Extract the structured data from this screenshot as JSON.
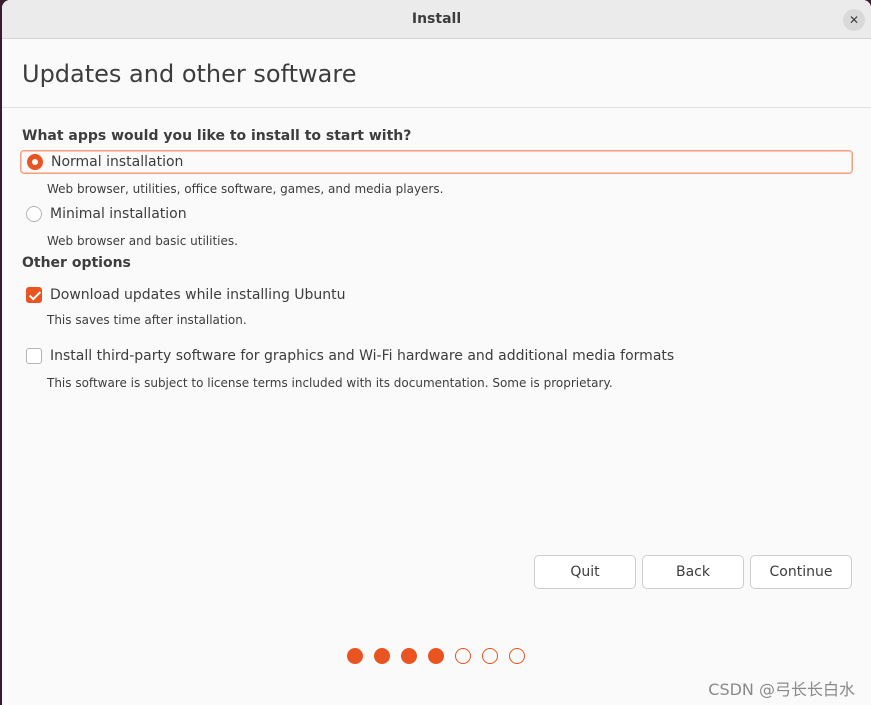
{
  "window": {
    "title": "Install",
    "close_glyph": "✕"
  },
  "page": {
    "title": "Updates and other software"
  },
  "apps_section": {
    "heading": "What apps would you like to install to start with?",
    "options": [
      {
        "label": "Normal installation",
        "description": "Web browser, utilities, office software, games, and media players.",
        "selected": true
      },
      {
        "label": "Minimal installation",
        "description": "Web browser and basic utilities.",
        "selected": false
      }
    ]
  },
  "other_section": {
    "heading": "Other options",
    "options": [
      {
        "label": "Download updates while installing Ubuntu",
        "description": "This saves time after installation.",
        "checked": true
      },
      {
        "label": "Install third-party software for graphics and Wi-Fi hardware and additional media formats",
        "description": "This software is subject to license terms included with its documentation. Some is proprietary.",
        "checked": false
      }
    ]
  },
  "buttons": {
    "quit": "Quit",
    "back": "Back",
    "continue": "Continue"
  },
  "progress": {
    "total_steps": 7,
    "completed_steps": 4
  },
  "watermark": "CSDN @弓长长白水",
  "colors": {
    "accent": "#e95420",
    "background": "#fafafa",
    "titlebar": "#ebebeb"
  }
}
